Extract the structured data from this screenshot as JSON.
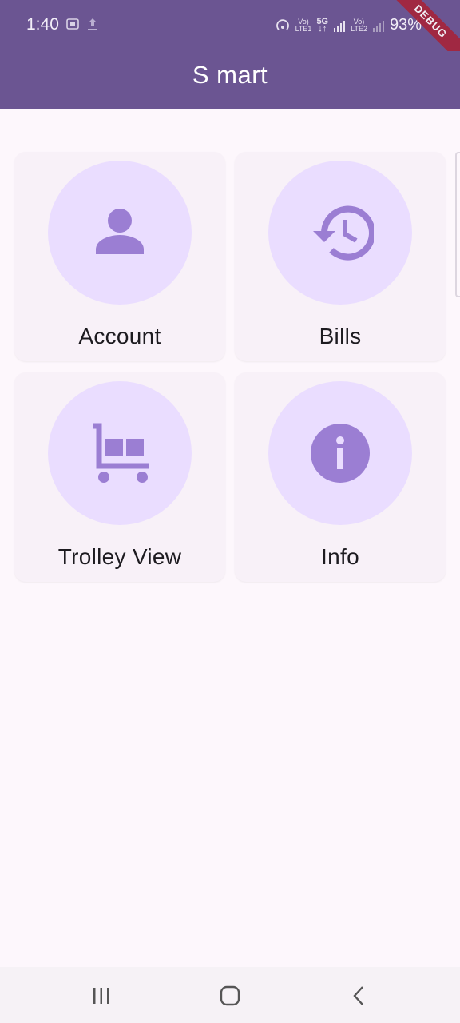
{
  "status_bar": {
    "time": "1:40",
    "battery": "93%",
    "icons": [
      "screenshot-icon",
      "upload-icon",
      "hotspot-icon",
      "volte-lte1-icon",
      "5g-icon",
      "signal-icon",
      "volte-lte2-icon",
      "signal-icon"
    ]
  },
  "app_bar": {
    "title": "S mart",
    "debug_banner": "DEBUG"
  },
  "menu": {
    "items": [
      {
        "label": "Account",
        "icon": "person-icon"
      },
      {
        "label": "Bills",
        "icon": "history-icon"
      },
      {
        "label": "Trolley View",
        "icon": "trolley-icon"
      },
      {
        "label": "Info",
        "icon": "info-icon"
      }
    ]
  },
  "colors": {
    "app_bar": "#6b5592",
    "background": "#fdf7fc",
    "card": "#f8f1f8",
    "circle": "#eaddff",
    "icon": "#9b7ed3"
  },
  "nav_bar": {
    "buttons": [
      "recents-icon",
      "home-icon",
      "back-icon"
    ]
  }
}
